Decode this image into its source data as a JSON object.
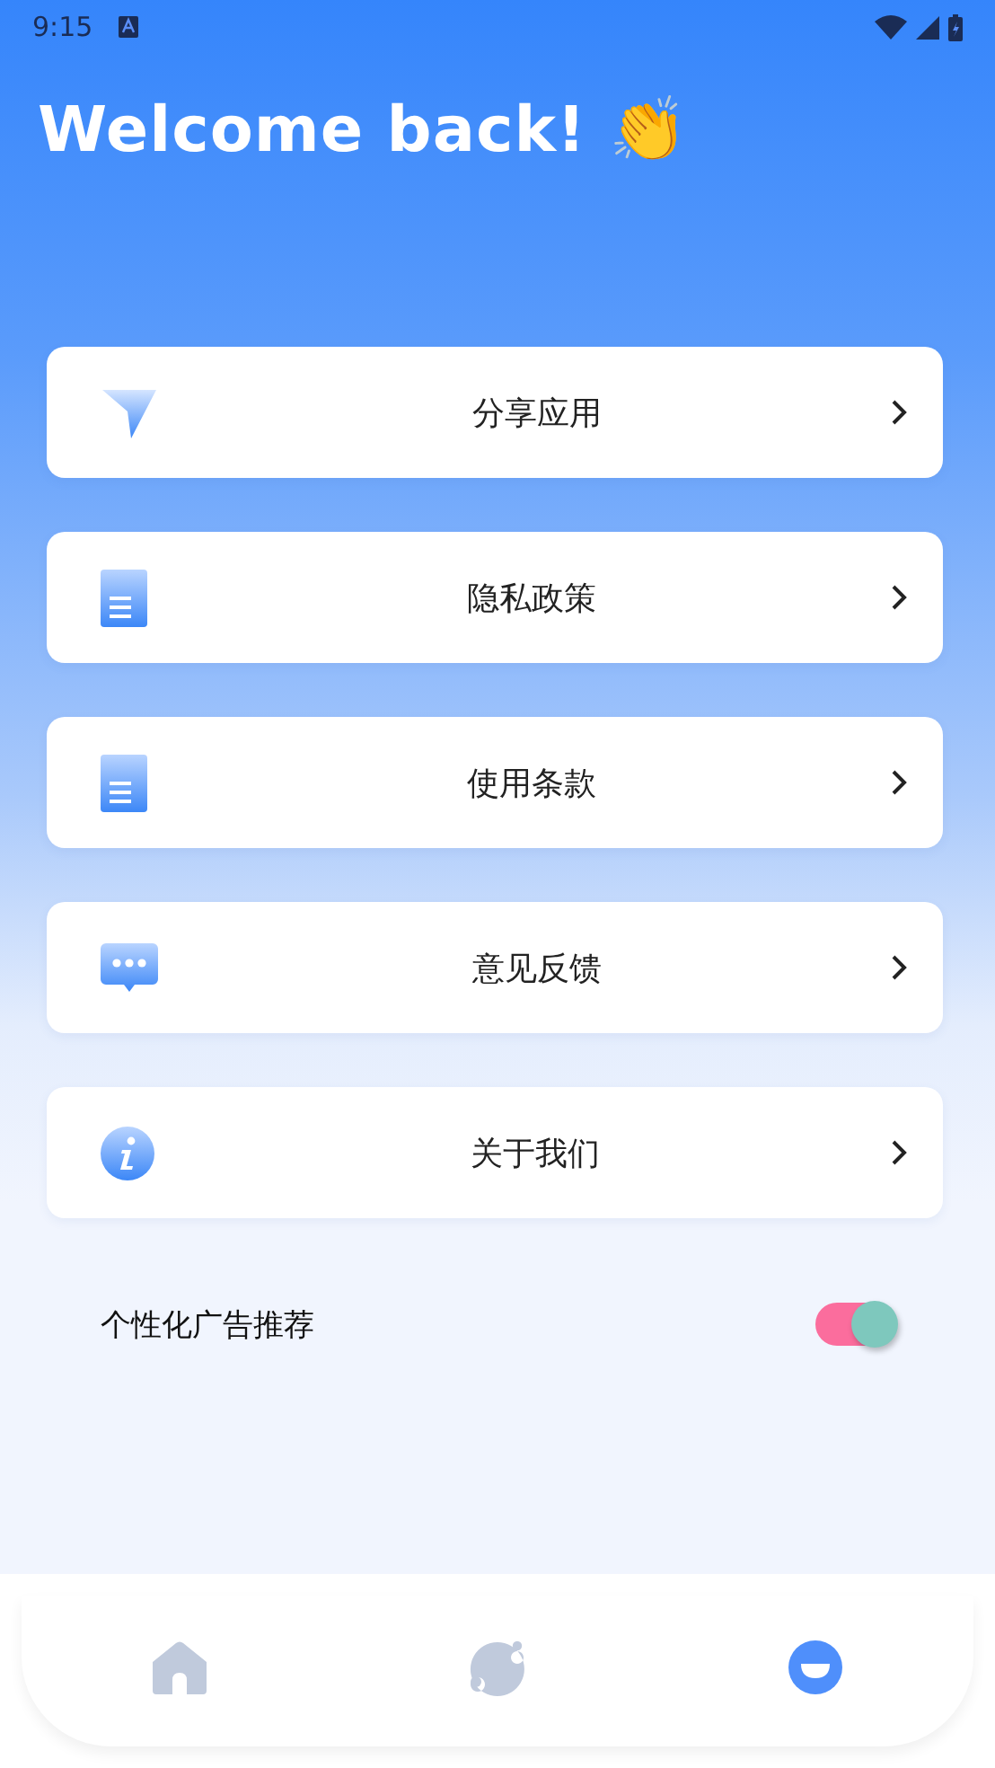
{
  "status_bar": {
    "time": "9:15"
  },
  "title": "Welcome back! 👏",
  "menu": [
    {
      "kind": "share",
      "label": "分享应用"
    },
    {
      "kind": "document",
      "label": "隐私政策"
    },
    {
      "kind": "document",
      "label": "使用条款"
    },
    {
      "kind": "chat",
      "label": "意见反馈"
    },
    {
      "kind": "info",
      "label": "关于我们"
    }
  ],
  "ad_setting": {
    "label": "个性化广告推荐",
    "on": true
  },
  "bottom_nav": [
    {
      "kind": "home",
      "selected": false
    },
    {
      "kind": "discover",
      "selected": false
    },
    {
      "kind": "profile",
      "selected": true
    }
  ]
}
